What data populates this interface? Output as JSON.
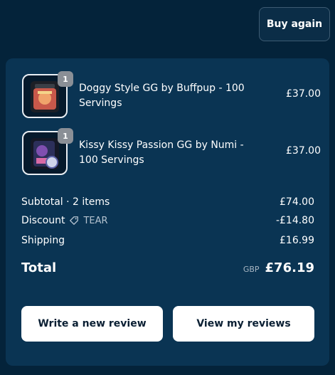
{
  "header": {
    "buy_again_label": "Buy again"
  },
  "items": [
    {
      "title": "Doggy Style GG by Buffpup - 100 Servings",
      "price": "£37.00",
      "quantity": "1",
      "icon": "product-thumbnail-icon"
    },
    {
      "title": "Kissy Kissy Passion GG by Numi - 100 Servings",
      "price": "£37.00",
      "quantity": "1",
      "icon": "product-thumbnail-icon"
    }
  ],
  "summary": {
    "subtotal_label": "Subtotal · 2 items",
    "subtotal_value": "£74.00",
    "discount_label": "Discount",
    "discount_code": "TEAR",
    "discount_icon": "tag-icon",
    "discount_value": "-£14.80",
    "shipping_label": "Shipping",
    "shipping_value": "£16.99",
    "total_label": "Total",
    "total_currency": "GBP",
    "total_value": "£76.19"
  },
  "actions": {
    "write_review_label": "Write a new review",
    "view_reviews_label": "View my reviews"
  },
  "colors": {
    "background": "#04233a",
    "panel": "#0a3453",
    "button_bg": "#ffffff",
    "button_text": "#0a1f33"
  }
}
